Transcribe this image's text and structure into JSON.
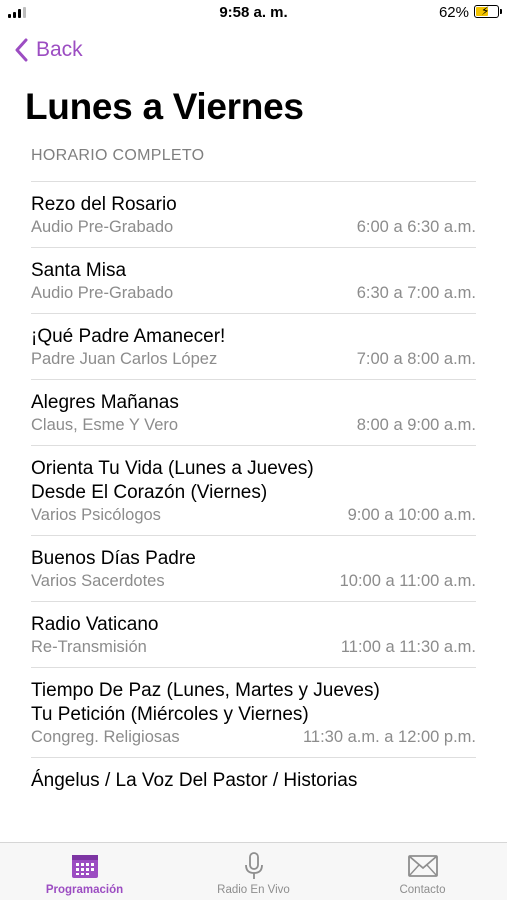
{
  "status_bar": {
    "time": "9:58 a. m.",
    "battery_percent": "62%",
    "battery_level": 0.62
  },
  "nav": {
    "back_label": "Back"
  },
  "page": {
    "title": "Lunes a Viernes",
    "section_header": "HORARIO COMPLETO"
  },
  "schedule": [
    {
      "title": "Rezo del Rosario",
      "subtitle": "Audio Pre-Grabado",
      "time": "6:00 a 6:30 a.m."
    },
    {
      "title": "Santa Misa",
      "subtitle": "Audio Pre-Grabado",
      "time": "6:30 a 7:00 a.m."
    },
    {
      "title": "¡Qué Padre Amanecer!",
      "subtitle": "Padre Juan Carlos López",
      "time": "7:00 a 8:00 a.m."
    },
    {
      "title": "Alegres Mañanas",
      "subtitle": "Claus, Esme Y Vero",
      "time": "8:00 a 9:00 a.m."
    },
    {
      "title": "Orienta Tu Vida (Lunes a Jueves)",
      "title_line2": "Desde El Corazón (Viernes)",
      "subtitle": "Varios Psicólogos",
      "time": "9:00 a 10:00 a.m."
    },
    {
      "title": "Buenos Días Padre",
      "subtitle": "Varios Sacerdotes",
      "time": "10:00 a 11:00 a.m."
    },
    {
      "title": "Radio Vaticano",
      "subtitle": "Re-Transmisión",
      "time": "11:00 a 11:30 a.m."
    },
    {
      "title": "Tiempo De Paz (Lunes, Martes y Jueves)",
      "title_line2": "Tu Petición (Miércoles y Viernes)",
      "subtitle": "Congreg. Religiosas",
      "time": "11:30 a.m. a 12:00 p.m."
    },
    {
      "title": "Ángelus / La Voz Del Pastor / Historias"
    }
  ],
  "tab_bar": {
    "tabs": [
      {
        "label": "Programación",
        "icon": "calendar-icon",
        "active": true
      },
      {
        "label": "Radio En Vivo",
        "icon": "microphone-icon",
        "active": false
      },
      {
        "label": "Contacto",
        "icon": "envelope-icon",
        "active": false
      }
    ]
  },
  "colors": {
    "accent": "#9c4dc2",
    "secondary_text": "#8c8c8c",
    "battery": "#f2c300"
  }
}
